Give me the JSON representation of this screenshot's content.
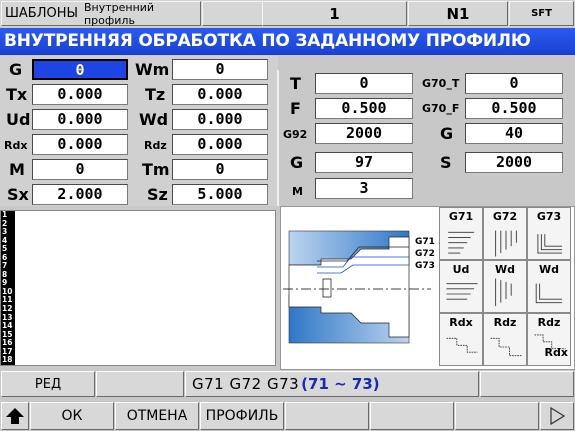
{
  "topbar": {
    "mode": "ШАБЛОНЫ",
    "subtitle": "Внутренний профиль",
    "counter": "1",
    "program": "N1",
    "shift": "SFT"
  },
  "title": "ВНУТРЕННЯЯ ОБРАБОТКА ПО ЗАДАННОМУ ПРОФИЛЮ",
  "left_params": [
    {
      "label": "G",
      "value": "0",
      "label2": "Wm",
      "value2": "0"
    },
    {
      "label": "Tx",
      "value": "0.000",
      "label2": "Tz",
      "value2": "0.000"
    },
    {
      "label": "Ud",
      "value": "0.000",
      "label2": "Wd",
      "value2": "0.000"
    },
    {
      "label": "Rdx",
      "value": "0.000",
      "label2": "Rdz",
      "value2": "0.000"
    },
    {
      "label": "M",
      "value": "0",
      "label2": "Tm",
      "value2": "0"
    },
    {
      "label": "Sx",
      "value": "2.000",
      "label2": "Sz",
      "value2": "5.000"
    }
  ],
  "right_params": {
    "T": "0",
    "F": "0.500",
    "G92": "2000",
    "G_left": "97",
    "M": "3",
    "G70_T": "0",
    "G70_F": "0.500",
    "G_right": "40",
    "S": "2000",
    "labels": {
      "T": "T",
      "F": "F",
      "G92": "G92",
      "G": "G",
      "M": "M",
      "G70_T": "G70_T",
      "G70_F": "G70_F",
      "G2": "G",
      "S": "S"
    }
  },
  "line_numbers": [
    "1",
    "2",
    "3",
    "4",
    "5",
    "6",
    "7",
    "8",
    "9",
    "10",
    "11",
    "12",
    "13",
    "14",
    "15",
    "16",
    "17",
    "18"
  ],
  "diagram": {
    "callouts": [
      "G71",
      "G72",
      "G73"
    ]
  },
  "tiles": [
    {
      "label": "G71",
      "icon": "g71-cycle-icon"
    },
    {
      "label": "G72",
      "icon": "g72-cycle-icon"
    },
    {
      "label": "G73",
      "icon": "g73-cycle-icon"
    },
    {
      "label": "Ud",
      "icon": "ud-allowance-icon"
    },
    {
      "label": "Wd",
      "icon": "wd-allowance-icon"
    },
    {
      "label": "Wd",
      "icon": "wd-profile-icon"
    },
    {
      "label": "Rdx",
      "icon": "rdx-step-icon"
    },
    {
      "label": "Rdz",
      "icon": "rdz-step-icon"
    },
    {
      "label": "Rdz",
      "label_b": "Rdx",
      "icon": "rdz-rdx-step-icon"
    }
  ],
  "status": {
    "mode": "РЕД",
    "hint_main": "G71 G72 G73",
    "hint_range": "(71 ~ 73)"
  },
  "softkeys": [
    "ОК",
    "ОТМЕНА",
    "ПРОФИЛЬ",
    "",
    "",
    "",
    ""
  ],
  "colors": {
    "accent": "#1e44e6",
    "range_text": "#1a2ab0"
  }
}
